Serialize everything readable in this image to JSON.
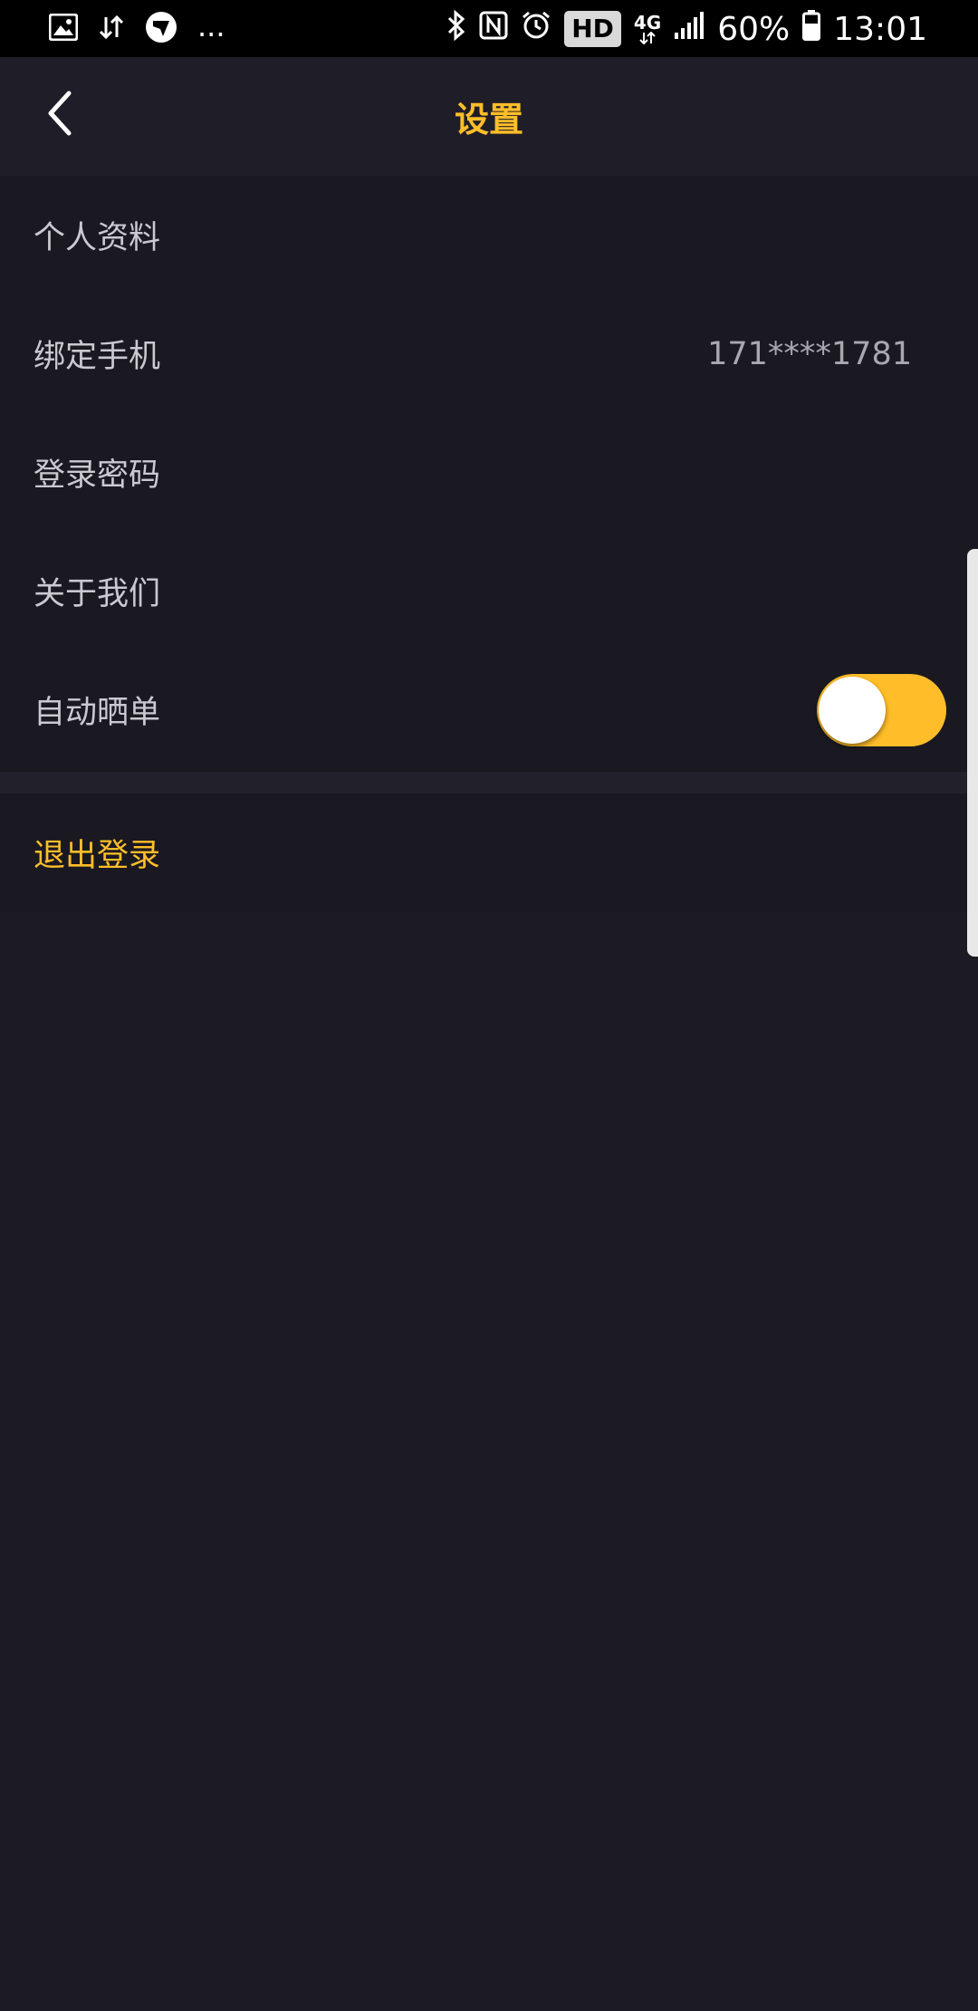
{
  "status_bar": {
    "icons_left": [
      "image-icon",
      "data-transfer-icon",
      "shield-app-icon",
      "more-notifications-icon"
    ],
    "more_text": "...",
    "icons_right": [
      "bluetooth-icon",
      "nfc-icon",
      "alarm-icon",
      "hd-badge",
      "4g-icon",
      "signal-icon",
      "battery-icon"
    ],
    "hd_label": "HD",
    "network_label": "4G",
    "battery_percent": "60%",
    "time": "13:01"
  },
  "header": {
    "title": "设置",
    "back_icon": "chevron-left-icon"
  },
  "settings": {
    "items": [
      {
        "label": "个人资料"
      },
      {
        "label": "绑定手机",
        "value": "171****1781"
      },
      {
        "label": "登录密码"
      },
      {
        "label": "关于我们"
      },
      {
        "label": "自动晒单",
        "toggle_on": true
      }
    ]
  },
  "logout": {
    "label": "退出登录"
  },
  "colors": {
    "accent": "#ffbe29",
    "background": "#1c1b24",
    "header_bg": "#1f1e28",
    "list_bg": "#1a1922",
    "text_primary": "#c9c9cf"
  }
}
